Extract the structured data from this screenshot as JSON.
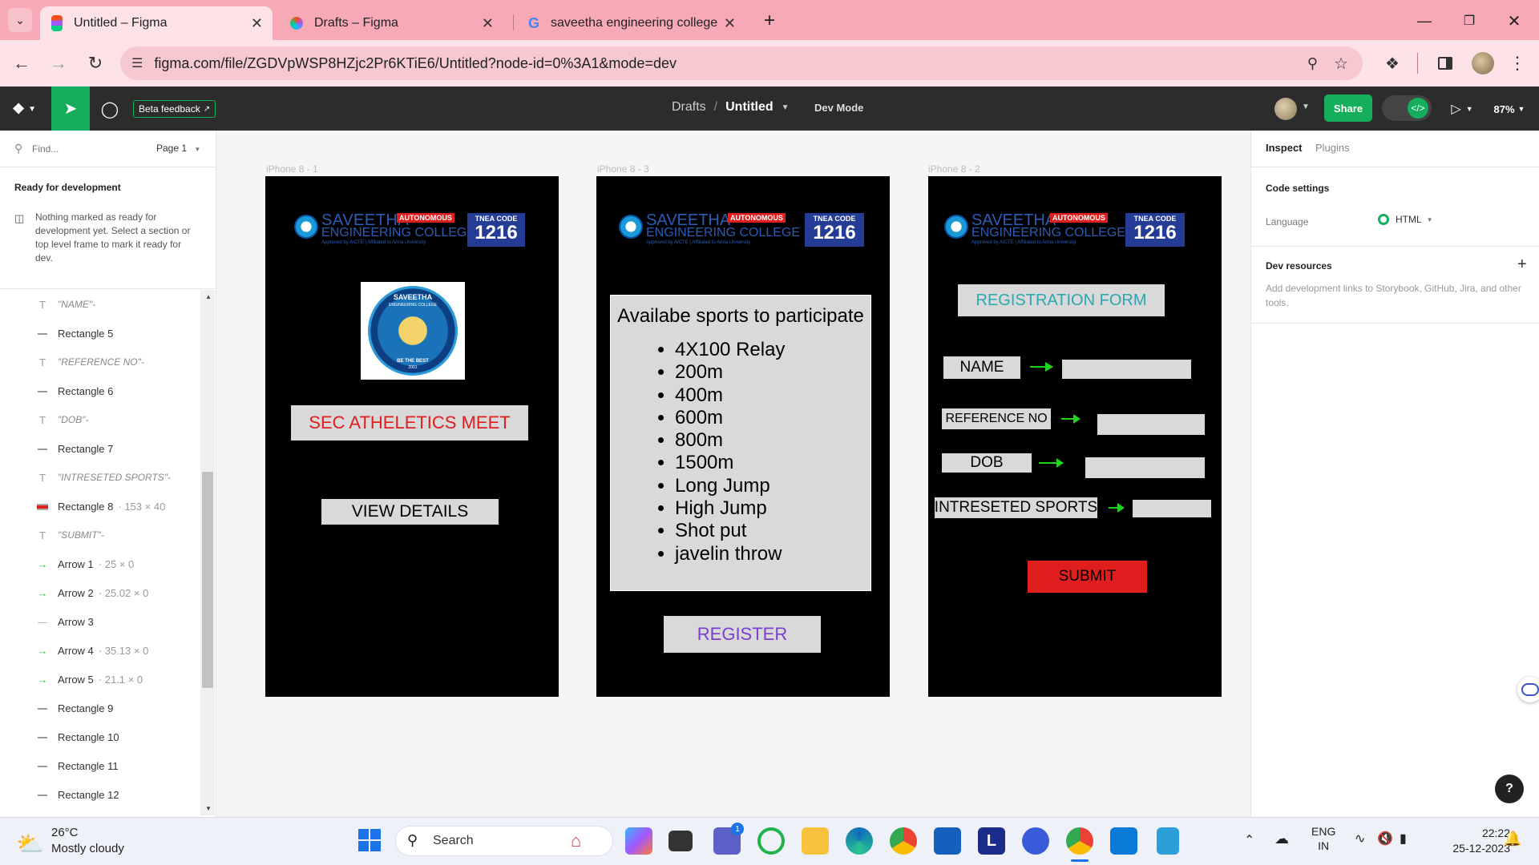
{
  "browser": {
    "tabs": [
      {
        "title": "Untitled – Figma"
      },
      {
        "title": "Drafts – Figma"
      },
      {
        "title": "saveetha engineering college S"
      }
    ],
    "url": "figma.com/file/ZGDVpWSP8HZjc2Pr6KTiE6/Untitled?node-id=0%3A1&mode=dev"
  },
  "figma": {
    "beta_feedback": "Beta feedback",
    "breadcrumb_folder": "Drafts",
    "breadcrumb_sep": "/",
    "file_name": "Untitled",
    "mode": "Dev Mode",
    "share": "Share",
    "zoom": "87%"
  },
  "left_panel": {
    "find_placeholder": "Find...",
    "page": "Page 1",
    "ready_title": "Ready for development",
    "ready_desc": "Nothing marked as ready for development yet. Select a section or top level frame to mark it ready for dev.",
    "layers": [
      {
        "name": "\"NAME\"-",
        "kind": "text"
      },
      {
        "name": "Rectangle 5",
        "kind": "rect"
      },
      {
        "name": "\"REFERENCE NO\"-",
        "kind": "text"
      },
      {
        "name": "Rectangle 6",
        "kind": "rect"
      },
      {
        "name": "\"DOB\"-",
        "kind": "text"
      },
      {
        "name": "Rectangle 7",
        "kind": "rect"
      },
      {
        "name": "\"INTRESETED SPORTS\"-",
        "kind": "text"
      },
      {
        "name": "Rectangle 8",
        "kind": "rect-red",
        "dims": "153 × 40"
      },
      {
        "name": "\"SUBMIT\"-",
        "kind": "text"
      },
      {
        "name": "Arrow 1",
        "kind": "arrow",
        "dims": "25 × 0"
      },
      {
        "name": "Arrow 2",
        "kind": "arrow",
        "dims": "25.02 × 0"
      },
      {
        "name": "Arrow 3",
        "kind": "line"
      },
      {
        "name": "Arrow 4",
        "kind": "arrow",
        "dims": "35.13 × 0"
      },
      {
        "name": "Arrow 5",
        "kind": "arrow",
        "dims": "21.1 × 0"
      },
      {
        "name": "Rectangle 9",
        "kind": "rect"
      },
      {
        "name": "Rectangle 10",
        "kind": "rect"
      },
      {
        "name": "Rectangle 11",
        "kind": "rect"
      },
      {
        "name": "Rectangle 12",
        "kind": "rect"
      }
    ]
  },
  "canvas": {
    "logo": {
      "line1": "SAVEETHA",
      "line2": "ENGINEERING COLLEGE",
      "badge": "AUTONOMOUS",
      "tnea": "TNEA CODE",
      "code": "1216",
      "sub": "Approved by AICTE | Affiliated to Anna University"
    },
    "frame1": {
      "label": "iPhone 8 - 1",
      "emblem_top": "SAVEETHA",
      "emblem_sub": "ENGINEERING COLLEGE",
      "emblem_motto": "BE THE BEST",
      "emblem_year": "2001",
      "title": "SEC ATHELETICS MEET",
      "button": "VIEW DETAILS"
    },
    "frame2": {
      "label": "iPhone 8 - 3",
      "heading": "Availabe sports to participate",
      "sports": [
        "4X100 Relay",
        "200m",
        "400m",
        "600m",
        "800m",
        "1500m",
        "Long Jump",
        "High Jump",
        "Shot put",
        "javelin throw"
      ],
      "button": "REGISTER"
    },
    "frame3": {
      "label": "iPhone 8 - 2",
      "title": "REGISTRATION FORM",
      "fields": [
        "NAME",
        "REFERENCE NO",
        "DOB",
        "INTRESETED SPORTS"
      ],
      "submit": "SUBMIT"
    }
  },
  "right_panel": {
    "tab_inspect": "Inspect",
    "tab_plugins": "Plugins",
    "code_settings": "Code settings",
    "language_label": "Language",
    "language_value": "HTML",
    "dev_resources": "Dev resources",
    "dev_desc": "Add development links to Storybook, GitHub, Jira, and other tools.",
    "help": "?"
  },
  "taskbar": {
    "temp": "26°C",
    "weather": "Mostly cloudy",
    "search": "Search",
    "lang1": "ENG",
    "lang2": "IN",
    "time": "22:22",
    "date": "25-12-2023",
    "teams_badge": "1",
    "l_app": "L"
  },
  "colors": {
    "figma_green": "#14ae5c",
    "accent_red": "#e11e1e",
    "arrow_green": "#1fd31f",
    "register_purple": "#7b3fcf",
    "regform_teal": "#2aa7b0"
  }
}
